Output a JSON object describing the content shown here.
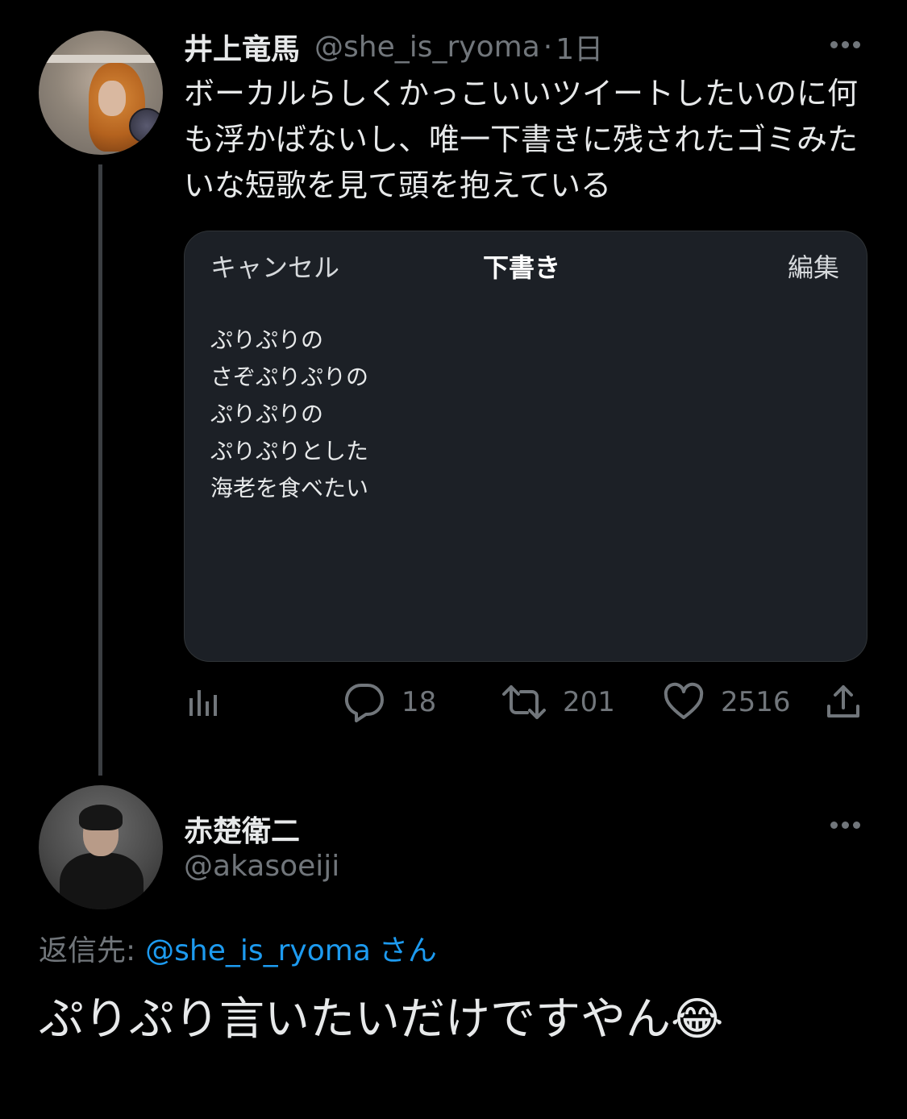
{
  "colors": {
    "background": "#000000",
    "text_primary": "#e7e9ea",
    "text_secondary": "#71767b",
    "link": "#1d9bf0",
    "card_background": "#1c2026",
    "thread_line": "#3b3e42"
  },
  "tweet1": {
    "display_name": "井上竜馬",
    "handle": "@she_is_ryoma",
    "dot": "·",
    "time": "1日",
    "more_icon": "more-horizontal-icon",
    "body": "ボーカルらしくかっこいいツイートしたいのに何も浮かばないし、唯一下書きに残されたゴミみたいな短歌を見て頭を抱えている",
    "card": {
      "cancel_label": "キャンセル",
      "title": "下書き",
      "edit_label": "編集",
      "draft_lines": [
        "ぷりぷりの",
        "さぞぷりぷりの",
        "ぷりぷりの",
        "ぷりぷりとした",
        "海老を食べたい"
      ]
    },
    "actions": {
      "views_icon": "analytics-icon",
      "reply_icon": "reply-icon",
      "reply_count": "18",
      "retweet_icon": "retweet-icon",
      "retweet_count": "201",
      "like_icon": "heart-icon",
      "like_count": "2516",
      "share_icon": "share-icon"
    }
  },
  "tweet2": {
    "display_name": "赤楚衛二",
    "handle": "@akasoeiji",
    "more_icon": "more-horizontal-icon",
    "reply_to_label": "返信先:",
    "reply_to_handle": "@she_is_ryoma",
    "reply_to_suffix": "さん",
    "body": "ぷりぷり言いたいだけですやん😂"
  }
}
